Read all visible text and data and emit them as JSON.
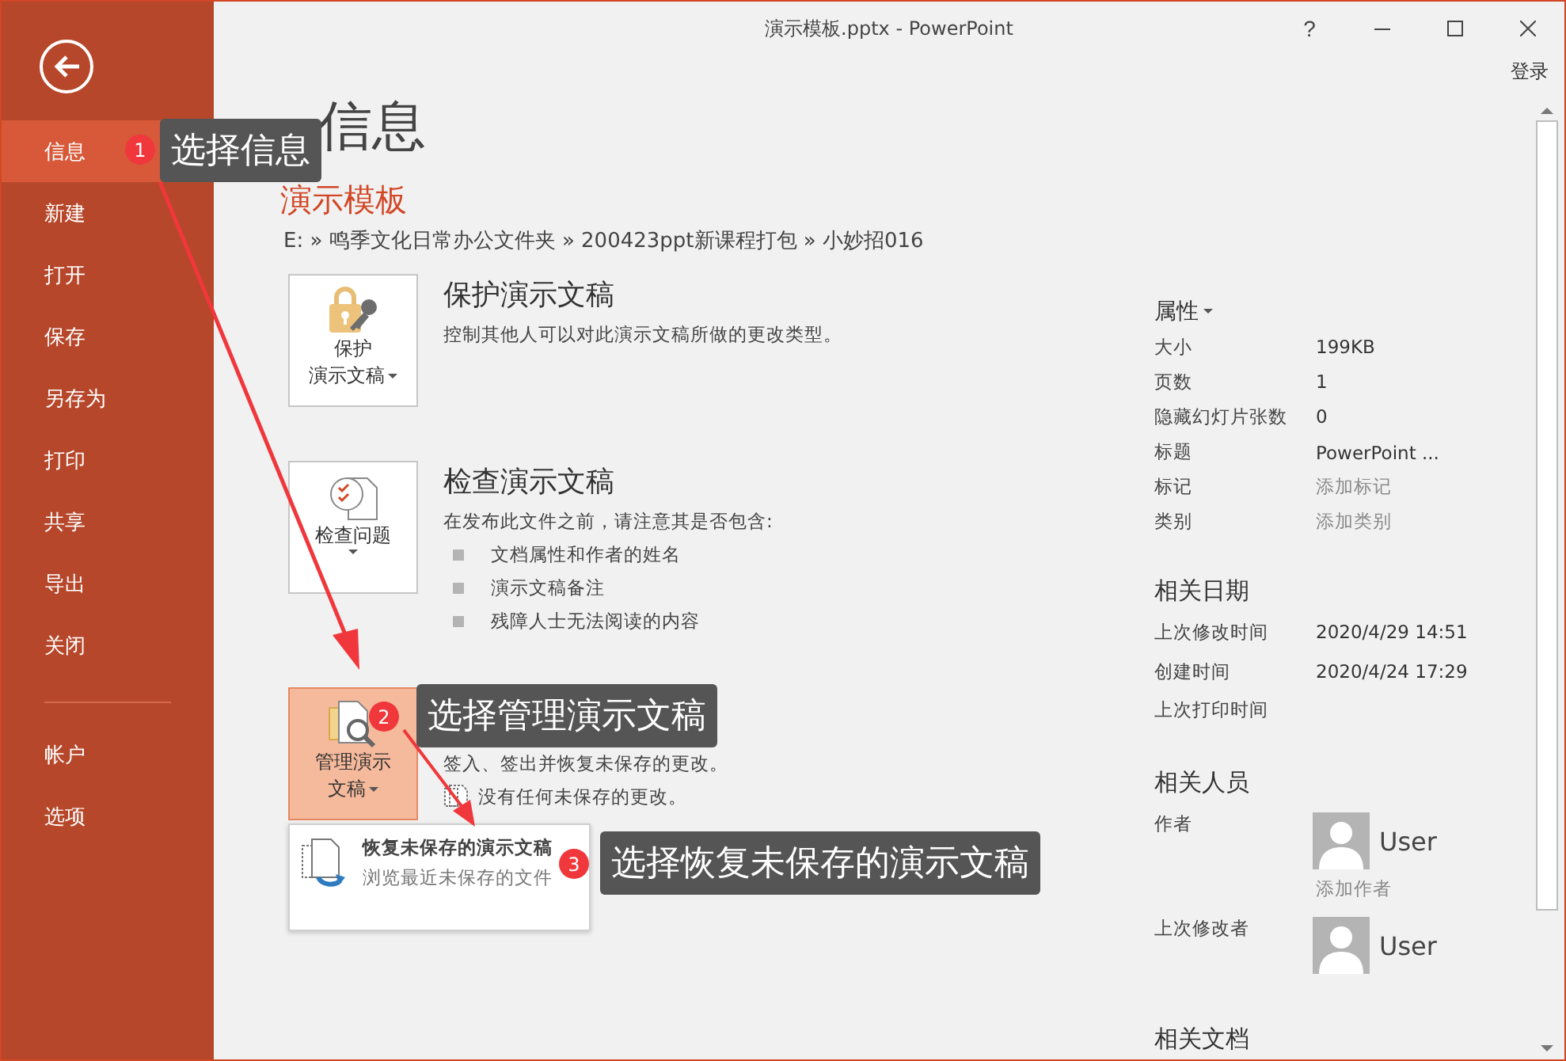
{
  "window": {
    "title": "演示模板.pptx - PowerPoint",
    "help": "?",
    "sign_in": "登录"
  },
  "sidebar": {
    "items": [
      {
        "label": "信息",
        "selected": true
      },
      {
        "label": "新建",
        "selected": false
      },
      {
        "label": "打开",
        "selected": false
      },
      {
        "label": "保存",
        "selected": false
      },
      {
        "label": "另存为",
        "selected": false
      },
      {
        "label": "打印",
        "selected": false
      },
      {
        "label": "共享",
        "selected": false
      },
      {
        "label": "导出",
        "selected": false
      },
      {
        "label": "关闭",
        "selected": false
      }
    ],
    "footer_items": [
      {
        "label": "帐户",
        "selected": false
      },
      {
        "label": "选项",
        "selected": false
      }
    ]
  },
  "page": {
    "heading": "信息",
    "file_name": "演示模板",
    "path": "E: » 鸣季文化日常办公文件夹 » 200423ppt新课程打包 » 小妙招016"
  },
  "sections": [
    {
      "kind": "protect",
      "button_lines": [
        "保护",
        "演示文稿"
      ],
      "highlighted": false,
      "title": "保护演示文稿",
      "description": "控制其他人可以对此演示文稿所做的更改类型。"
    },
    {
      "kind": "inspect",
      "button_lines": [
        "检查问题"
      ],
      "highlighted": false,
      "title": "检查演示文稿",
      "description": "在发布此文件之前，请注意其是否包含:",
      "bullets": [
        "文档属性和作者的姓名",
        "演示文稿备注",
        "残障人士无法阅读的内容"
      ]
    },
    {
      "kind": "manage",
      "button_lines": [
        "管理演示",
        "文稿"
      ],
      "highlighted": true,
      "description": "签入、签出并恢复未保存的更改。",
      "note": "没有任何未保存的更改。",
      "menu": [
        {
          "title": "恢复未保存的演示文稿",
          "subtitle": "浏览最近未保存的文件"
        }
      ]
    }
  ],
  "properties": {
    "heading": "属性",
    "rows": [
      {
        "label": "大小",
        "value": "199KB",
        "link": false
      },
      {
        "label": "页数",
        "value": "1",
        "link": false
      },
      {
        "label": "隐藏幻灯片张数",
        "value": "0",
        "link": false
      },
      {
        "label": "标题",
        "value": "PowerPoint ...",
        "link": false
      },
      {
        "label": "标记",
        "value": "添加标记",
        "link": true
      },
      {
        "label": "类别",
        "value": "添加类别",
        "link": true
      }
    ]
  },
  "dates": {
    "heading": "相关日期",
    "rows": [
      {
        "label": "上次修改时间",
        "value": "2020/4/29 14:51"
      },
      {
        "label": "创建时间",
        "value": "2020/4/24 17:29"
      },
      {
        "label": "上次打印时间"
      }
    ]
  },
  "people": {
    "heading": "相关人员",
    "rows": [
      {
        "label": "作者",
        "name": "User",
        "add": "添加作者"
      },
      {
        "label": "上次修改者",
        "name": "User"
      }
    ]
  },
  "related_docs": {
    "heading": "相关文档"
  },
  "annotations": [
    {
      "number": "1",
      "text": "选择信息"
    },
    {
      "number": "2",
      "text": "选择管理演示文稿"
    },
    {
      "number": "3",
      "text": "选择恢复未保存的演示文稿"
    }
  ]
}
